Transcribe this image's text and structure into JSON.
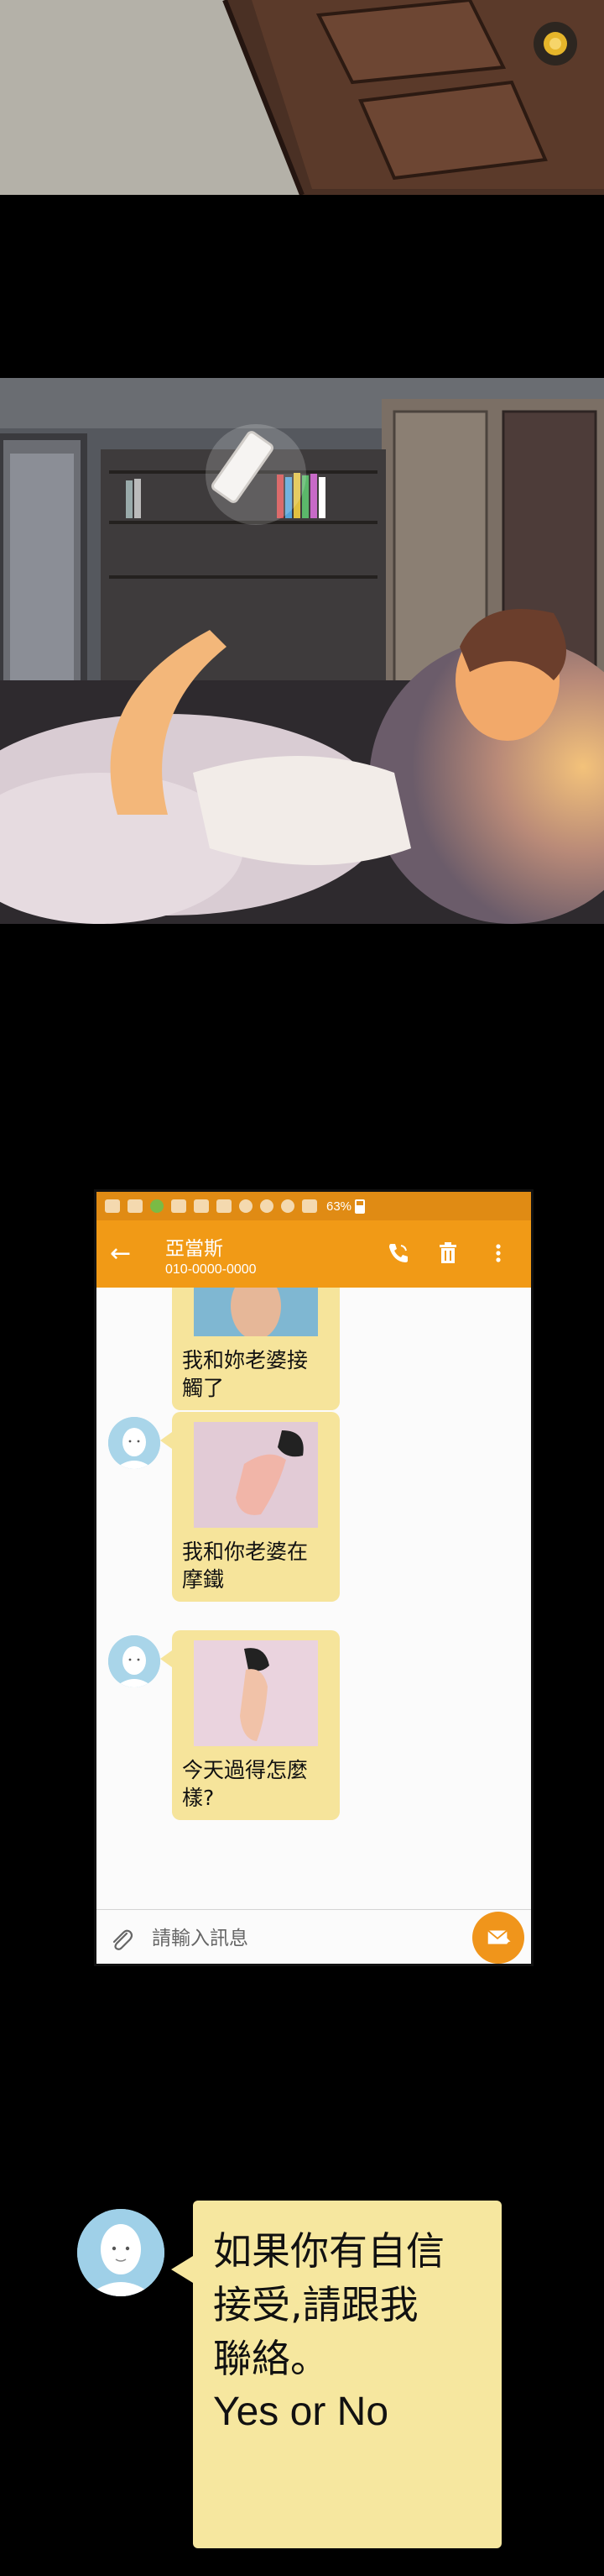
{
  "phone": {
    "status_bar": {
      "battery": "63%",
      "icons": [
        "chat-notification-icon",
        "person-icon",
        "phone-notification-icon",
        "app-icon",
        "gallery-icon",
        "mail-icon",
        "bluetooth-icon",
        "alarm-icon",
        "wifi-icon",
        "signal-icon"
      ]
    },
    "app_bar": {
      "contact_name": "亞當斯",
      "contact_number": "010-0000-0000",
      "back_icon": "arrow-left-icon",
      "actions": [
        "call-icon",
        "trash-icon",
        "more-vert-icon"
      ]
    },
    "messages": [
      {
        "text": "我和妳老婆接\n觸了",
        "has_photo": true
      },
      {
        "text": "我和你老婆在\n摩鐵",
        "has_photo": true
      },
      {
        "text": "今天過得怎麼\n樣?",
        "has_photo": true
      }
    ],
    "input": {
      "placeholder": "請輸入訊息",
      "attach_icon": "paperclip-icon",
      "send_icon": "send-mail-icon"
    },
    "colors": {
      "app_bar": "#f19a16",
      "status_bar": "#e08b14",
      "bubble": "#f6e49b",
      "avatar": "#a9d5e9"
    }
  },
  "final_message": {
    "text_zh": "如果你有自信\n接受,請跟我\n聯絡。",
    "text_en": "Yes or No"
  }
}
